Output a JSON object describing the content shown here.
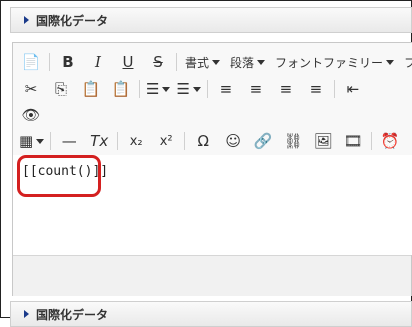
{
  "section_top": {
    "title": "国際化データ"
  },
  "section_bottom": {
    "title": "国際化データ"
  },
  "toolbar": {
    "row1": {
      "format": "書式",
      "paragraph": "段落",
      "font_family": "フォントファミリー",
      "font_cut": "フォ"
    },
    "icons": {
      "new_doc": "📄",
      "bold": "B",
      "italic": "I",
      "underline": "U",
      "strike": "S",
      "cut": "✂",
      "copy": "⎘",
      "paste": "📋",
      "paste_text": "📋",
      "bullet_list": "☰",
      "numbered_list": "☰",
      "align_left": "≡",
      "align_center": "≡",
      "align_right": "≡",
      "justify": "≡",
      "outdent": "⇤",
      "preview": "👁",
      "table": "▦",
      "hr": "—",
      "clear_format": "Tx",
      "subscript": "x₂",
      "superscript": "x²",
      "omega": "Ω",
      "emoji": "☺",
      "link": "🔗",
      "unlink": "⛓",
      "image": "🖼",
      "media": "🎞",
      "clock": "⏰"
    }
  },
  "editor": {
    "content": "[[count()]]"
  }
}
